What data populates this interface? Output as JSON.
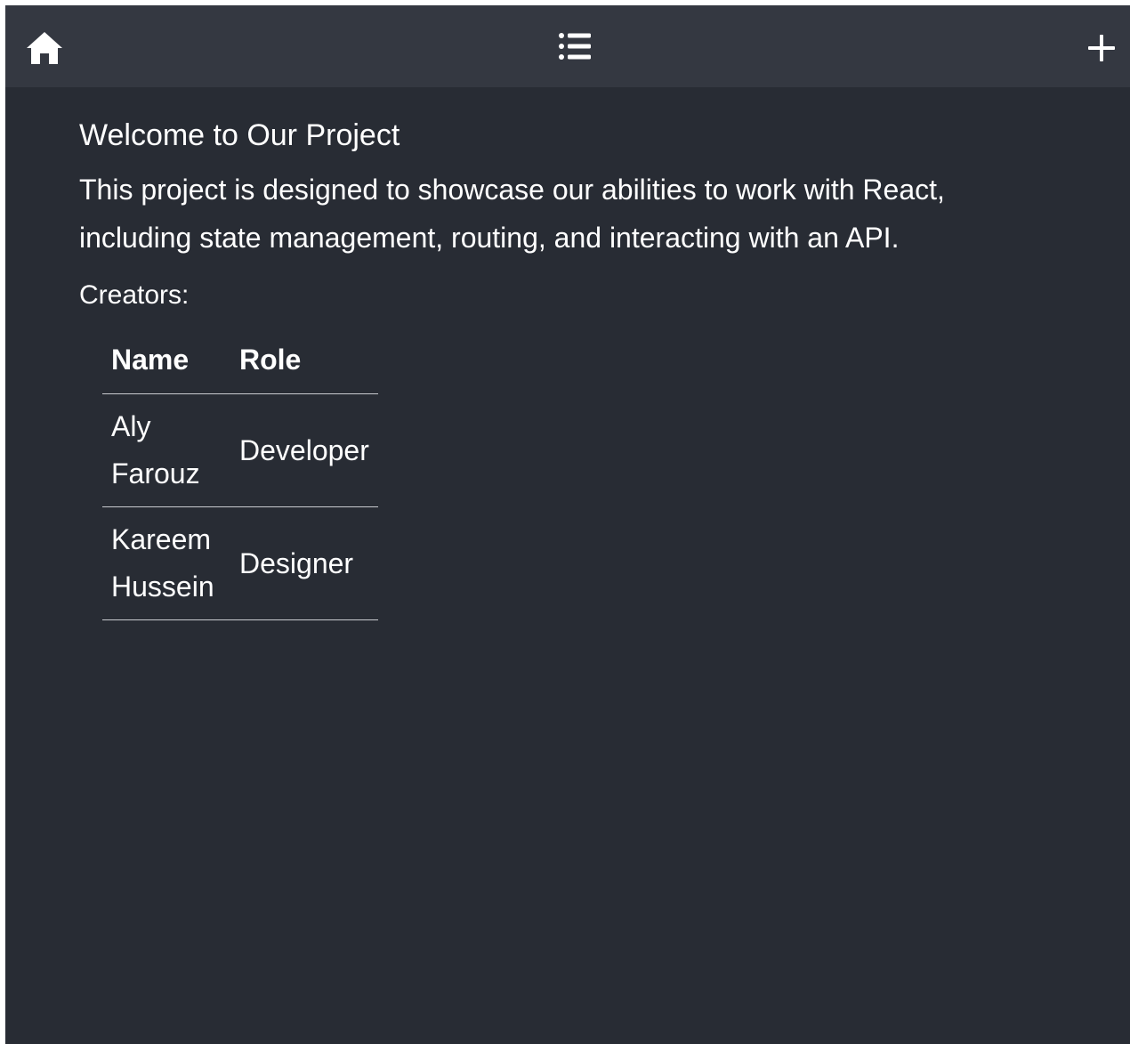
{
  "navbar": {
    "home_icon": "home-icon",
    "list_icon": "list-icon",
    "add_icon": "plus-icon"
  },
  "main": {
    "title": "Welcome to Our Project",
    "description": "This project is designed to showcase our abilities to work with React, including state management, routing, and interacting with an API.",
    "creators_label": "Creators:",
    "table": {
      "headers": [
        "Name",
        "Role"
      ],
      "rows": [
        {
          "name": "Aly Farouz",
          "role": "Developer"
        },
        {
          "name": "Kareem Hussein",
          "role": "Designer"
        }
      ]
    }
  },
  "colors": {
    "background": "#282c34",
    "navbar": "#343841",
    "text": "#ffffff"
  }
}
